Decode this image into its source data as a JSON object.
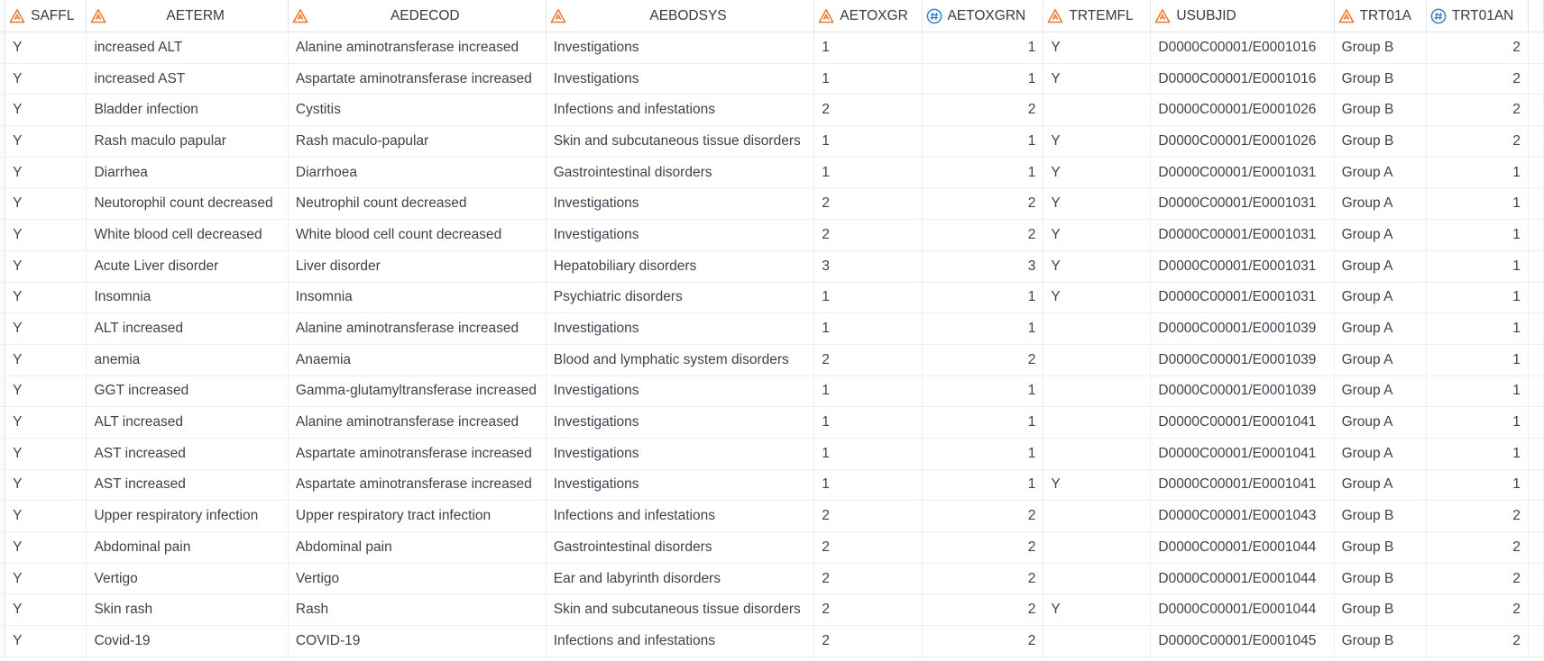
{
  "columns": [
    {
      "name": "SAFFL",
      "type": "char"
    },
    {
      "name": "AETERM",
      "type": "char"
    },
    {
      "name": "AEDECOD",
      "type": "char"
    },
    {
      "name": "AEBODSYS",
      "type": "char"
    },
    {
      "name": "AETOXGR",
      "type": "char"
    },
    {
      "name": "AETOXGRN",
      "type": "numeric"
    },
    {
      "name": "TRTEMFL",
      "type": "char"
    },
    {
      "name": "USUBJID",
      "type": "char"
    },
    {
      "name": "TRT01A",
      "type": "char"
    },
    {
      "name": "TRT01AN",
      "type": "numeric"
    }
  ],
  "colors": {
    "char_icon": "#e8762c",
    "numeric_icon": "#2f7fd1"
  },
  "icons": {
    "char": "triangle-char-icon",
    "numeric": "circle-hash-numeric-icon"
  },
  "rows": [
    [
      "Y",
      "increased ALT",
      "Alanine aminotransferase increased",
      "Investigations",
      "1",
      "1",
      "Y",
      "D0000C00001/E0001016",
      "Group B",
      "2"
    ],
    [
      "Y",
      "increased AST",
      "Aspartate aminotransferase increased",
      "Investigations",
      "1",
      "1",
      "Y",
      "D0000C00001/E0001016",
      "Group B",
      "2"
    ],
    [
      "Y",
      "Bladder infection",
      "Cystitis",
      "Infections and infestations",
      "2",
      "2",
      "",
      "D0000C00001/E0001026",
      "Group B",
      "2"
    ],
    [
      "Y",
      "Rash maculo papular",
      "Rash maculo-papular",
      "Skin and subcutaneous tissue disorders",
      "1",
      "1",
      "Y",
      "D0000C00001/E0001026",
      "Group B",
      "2"
    ],
    [
      "Y",
      "Diarrhea",
      "Diarrhoea",
      "Gastrointestinal disorders",
      "1",
      "1",
      "Y",
      "D0000C00001/E0001031",
      "Group A",
      "1"
    ],
    [
      "Y",
      "Neutorophil count decreased",
      "Neutrophil count decreased",
      "Investigations",
      "2",
      "2",
      "Y",
      "D0000C00001/E0001031",
      "Group A",
      "1"
    ],
    [
      "Y",
      "White blood cell decreased",
      "White blood cell count decreased",
      "Investigations",
      "2",
      "2",
      "Y",
      "D0000C00001/E0001031",
      "Group A",
      "1"
    ],
    [
      "Y",
      "Acute Liver disorder",
      "Liver disorder",
      "Hepatobiliary disorders",
      "3",
      "3",
      "Y",
      "D0000C00001/E0001031",
      "Group A",
      "1"
    ],
    [
      "Y",
      "Insomnia",
      "Insomnia",
      "Psychiatric disorders",
      "1",
      "1",
      "Y",
      "D0000C00001/E0001031",
      "Group A",
      "1"
    ],
    [
      "Y",
      "ALT increased",
      "Alanine aminotransferase increased",
      "Investigations",
      "1",
      "1",
      "",
      "D0000C00001/E0001039",
      "Group A",
      "1"
    ],
    [
      "Y",
      "anemia",
      "Anaemia",
      "Blood and lymphatic system disorders",
      "2",
      "2",
      "",
      "D0000C00001/E0001039",
      "Group A",
      "1"
    ],
    [
      "Y",
      "GGT increased",
      "Gamma-glutamyltransferase increased",
      "Investigations",
      "1",
      "1",
      "",
      "D0000C00001/E0001039",
      "Group A",
      "1"
    ],
    [
      "Y",
      "ALT increased",
      "Alanine aminotransferase increased",
      "Investigations",
      "1",
      "1",
      "",
      "D0000C00001/E0001041",
      "Group A",
      "1"
    ],
    [
      "Y",
      "AST increased",
      "Aspartate aminotransferase increased",
      "Investigations",
      "1",
      "1",
      "",
      "D0000C00001/E0001041",
      "Group A",
      "1"
    ],
    [
      "Y",
      "AST increased",
      "Aspartate aminotransferase increased",
      "Investigations",
      "1",
      "1",
      "Y",
      "D0000C00001/E0001041",
      "Group A",
      "1"
    ],
    [
      "Y",
      "Upper respiratory infection",
      "Upper respiratory tract infection",
      "Infections and infestations",
      "2",
      "2",
      "",
      "D0000C00001/E0001043",
      "Group B",
      "2"
    ],
    [
      "Y",
      "Abdominal pain",
      "Abdominal pain",
      "Gastrointestinal disorders",
      "2",
      "2",
      "",
      "D0000C00001/E0001044",
      "Group B",
      "2"
    ],
    [
      "Y",
      "Vertigo",
      "Vertigo",
      "Ear and labyrinth disorders",
      "2",
      "2",
      "",
      "D0000C00001/E0001044",
      "Group B",
      "2"
    ],
    [
      "Y",
      "Skin rash",
      "Rash",
      "Skin and subcutaneous tissue disorders",
      "2",
      "2",
      "Y",
      "D0000C00001/E0001044",
      "Group B",
      "2"
    ],
    [
      "Y",
      "Covid-19",
      "COVID-19",
      "Infections and infestations",
      "2",
      "2",
      "",
      "D0000C00001/E0001045",
      "Group B",
      "2"
    ]
  ]
}
